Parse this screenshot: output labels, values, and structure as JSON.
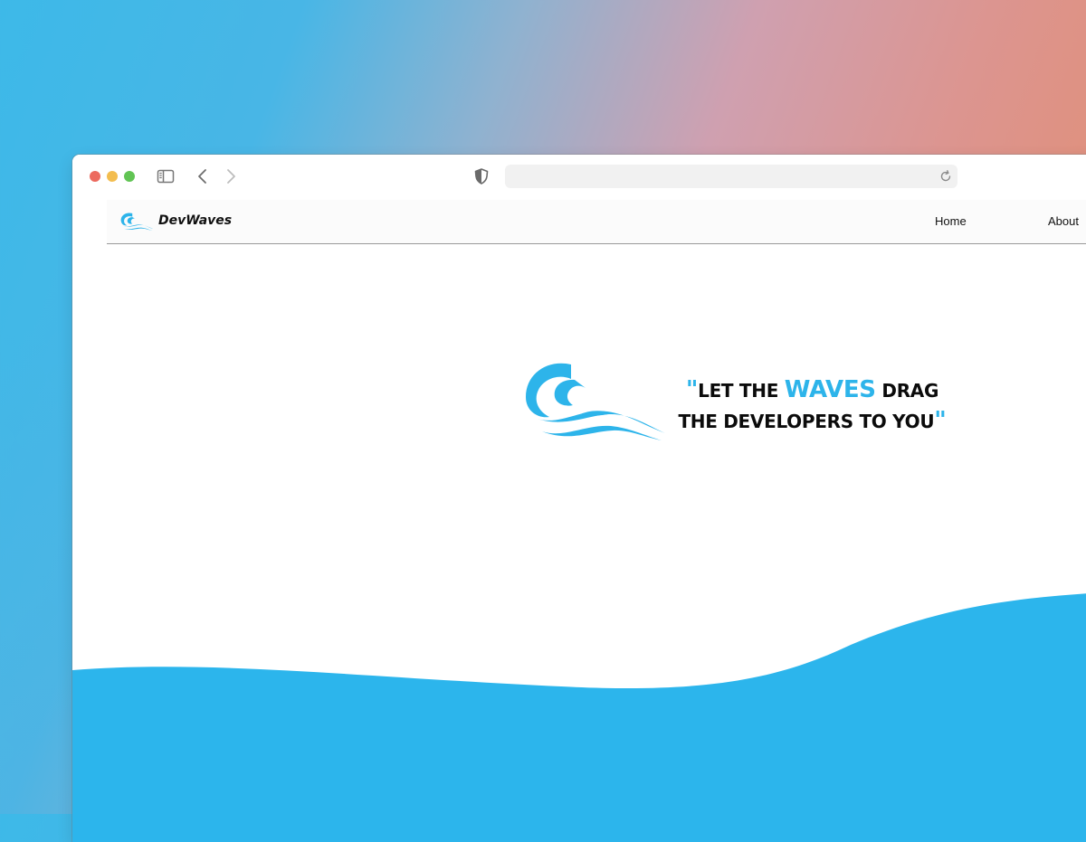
{
  "colors": {
    "accent": "#2db4ea",
    "wave_fill": "#2cb5ec",
    "text_dark": "#0b0b0b"
  },
  "browser": {
    "traffic_lights": [
      "close",
      "minimize",
      "zoom"
    ],
    "toolbar_icons": [
      "sidebar-toggle-icon",
      "back-arrow-icon",
      "forward-arrow-icon",
      "shield-icon",
      "reload-icon"
    ],
    "url": ""
  },
  "navbar": {
    "brand": "DevWaves",
    "brand_icon": "wave-logo-icon",
    "links": [
      {
        "label": "Home"
      },
      {
        "label": "About"
      }
    ]
  },
  "hero": {
    "logo_icon": "wave-logo-icon",
    "tagline": {
      "open_quote": "\"",
      "part1": "LET THE ",
      "highlight": "WAVES",
      "part2": " DRAG",
      "line2": "THE DEVELOPERS TO YOU",
      "close_quote": "\""
    }
  }
}
